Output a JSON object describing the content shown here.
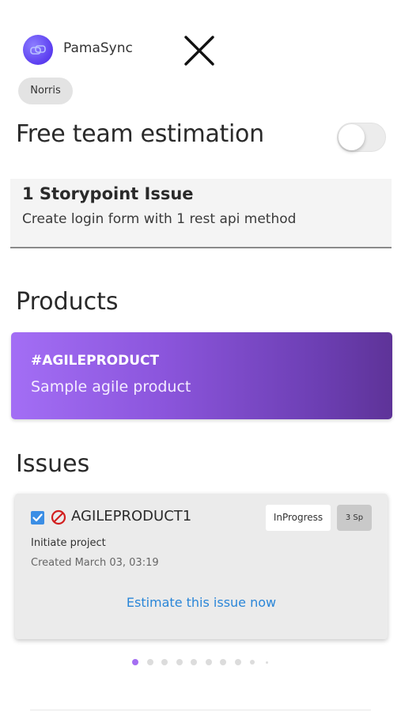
{
  "header": {
    "app_name": "PamaSync",
    "user_chip": "Norris"
  },
  "estimation": {
    "title": "Free team estimation",
    "toggle_on": false
  },
  "storypoint": {
    "title": "1 Storypoint Issue",
    "description": "Create login form with 1 rest api method"
  },
  "products": {
    "title": "Products",
    "items": [
      {
        "code": "#AGILEPRODUCT",
        "name": "Sample agile product"
      }
    ]
  },
  "issues": {
    "title": "Issues",
    "items": [
      {
        "key": "AGILEPRODUCT1",
        "status": "InProgress",
        "points": "3 Sp",
        "description": "Initiate project",
        "created": "Created March 03, 03:19",
        "action": "Estimate this issue now",
        "checked": true
      }
    ]
  },
  "pager": {
    "total": 10,
    "active_index": 0,
    "active_color": "#a46ef2",
    "inactive_color": "#dcdcdc"
  },
  "colors": {
    "link": "#2a86d8",
    "checkbox": "#3b8ee5",
    "block_icon": "#d21f1f",
    "product_gradient_start": "#a36ef5",
    "product_gradient_end": "#5e3398"
  }
}
